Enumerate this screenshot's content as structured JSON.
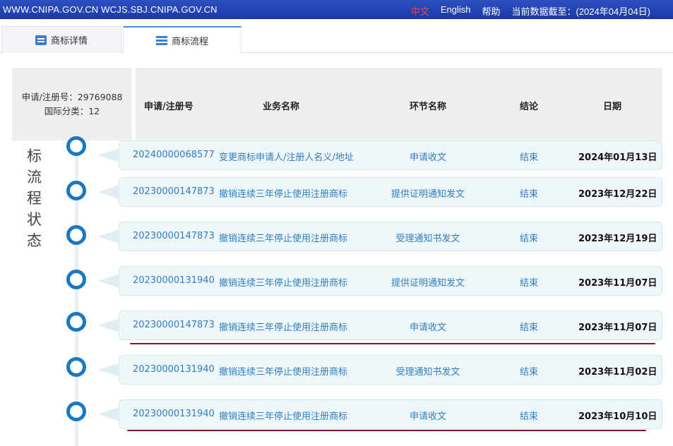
{
  "topbar": {
    "site": "WWW.CNIPA.GOV.CN WCJS.SBJ.CNIPA.GOV.CN",
    "lang_zh": "中文",
    "lang_en": "English",
    "help": "帮助",
    "data_as_of": "当前数据截至：(2024年04月04日)"
  },
  "tabs": [
    {
      "label": "商标详情",
      "icon": "document-icon"
    },
    {
      "label": "商标流程",
      "icon": "list-icon"
    }
  ],
  "info": {
    "reg_no": "申请/注册号：29769088",
    "intl_class": "国际分类：12"
  },
  "side_title": "标流程状态",
  "table": {
    "headers": [
      "申请/注册号",
      "业务名称",
      "环节名称",
      "结论",
      "日期"
    ],
    "rows": [
      {
        "no": "20240000068577",
        "biz": "变更商标申请人/注册人名义/地址",
        "node": "申请收文",
        "result": "结束",
        "date": "2024年01月13日"
      },
      {
        "no": "20230000147873",
        "biz": "撤销连续三年停止使用注册商标",
        "node": "提供证明通知发文",
        "result": "结束",
        "date": "2023年12月22日"
      },
      {
        "no": "20230000147873",
        "biz": "撤销连续三年停止使用注册商标",
        "node": "受理通知书发文",
        "result": "结束",
        "date": "2023年12月19日"
      },
      {
        "no": "20230000131940",
        "biz": "撤销连续三年停止使用注册商标",
        "node": "提供证明通知发文",
        "result": "结束",
        "date": "2023年11月07日"
      },
      {
        "no": "20230000147873",
        "biz": "撤销连续三年停止使用注册商标",
        "node": "申请收文",
        "result": "结束",
        "date": "2023年11月07日"
      },
      {
        "no": "20230000131940",
        "biz": "撤销连续三年停止使用注册商标",
        "node": "受理通知书发文",
        "result": "结束",
        "date": "2023年11月02日"
      },
      {
        "no": "20230000131940",
        "biz": "撤销连续三年停止使用注册商标",
        "node": "申请收文",
        "result": "结束",
        "date": "2023年10月10日"
      }
    ]
  },
  "colors": {
    "accent": "#1a78c2",
    "link": "#2f7fc4",
    "underline": "#7a1636"
  }
}
